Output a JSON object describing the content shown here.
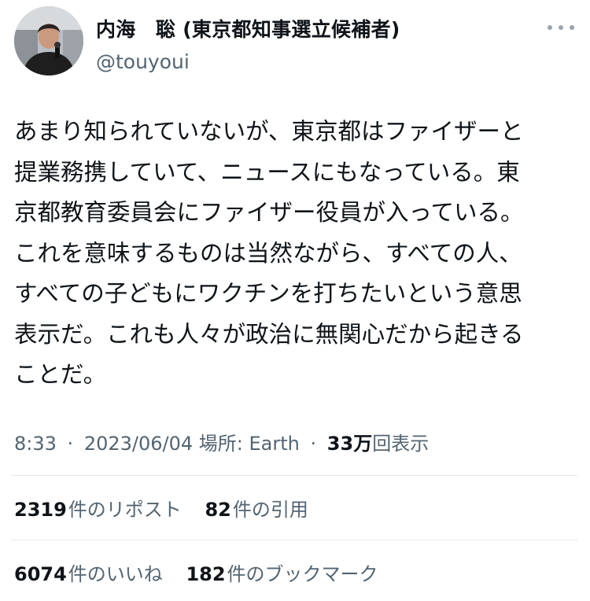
{
  "author": {
    "display_name": "内海　聡 (東京都知事選立候補者)",
    "handle": "@touyoui"
  },
  "tweet": {
    "lines": [
      "あまり知られていないが、東京都はファイザーと",
      "提業務携していて、ニュースにもなっている。東",
      "京都教育委員会にファイザー役員が入っている。",
      "これを意味するものは当然ながら、すべての人、",
      "すべての子どもにワクチンを打ちたいという意思",
      "表示だ。これも人々が政治に無関心だから起きる",
      "ことだ。"
    ]
  },
  "meta": {
    "time": "8:33",
    "separator": "·",
    "date": "2023/06/04",
    "location": "場所: Earth",
    "views_count": "33万",
    "views_label": "回表示"
  },
  "stats": {
    "reposts": {
      "count": "2319",
      "label": "件のリポスト"
    },
    "quotes": {
      "count": "82",
      "label": "件の引用"
    },
    "likes": {
      "count": "6074",
      "label": "件のいいね"
    },
    "bookmarks": {
      "count": "182",
      "label": "件のブックマーク"
    }
  },
  "icons": {
    "more": "more-horizontal-icon",
    "avatar": "avatar-photo"
  },
  "colors": {
    "text_primary": "#0f1419",
    "text_secondary": "#536471",
    "divider": "#e4e8eb",
    "more_dots": "#9aa4ad"
  }
}
